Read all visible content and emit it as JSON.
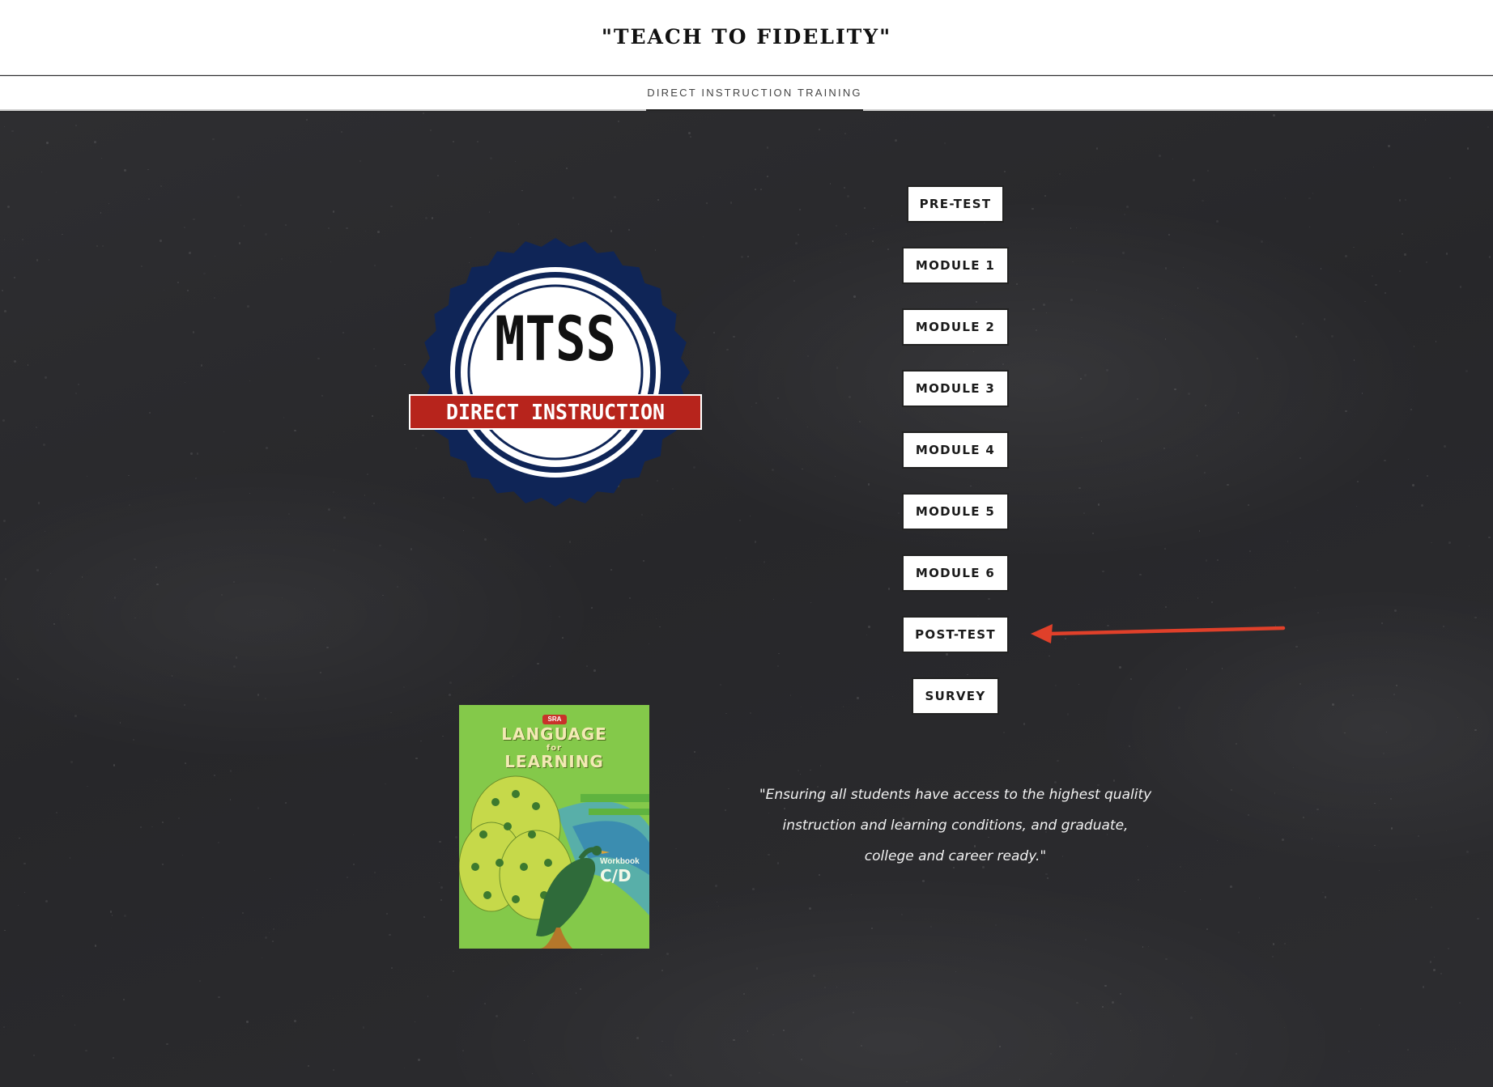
{
  "header": {
    "title": "\"TEACH TO FIDELITY\""
  },
  "nav": {
    "items": [
      {
        "label": "DIRECT INSTRUCTION TRAINING",
        "active": true
      }
    ]
  },
  "logo": {
    "name": "mtss-direct-instruction-badge",
    "line1": "MTSS",
    "banner": "DIRECT INSTRUCTION",
    "colors": {
      "ring": "#0f2557",
      "banner": "#b7241c"
    }
  },
  "buttons": [
    {
      "label": "PRE-TEST"
    },
    {
      "label": "MODULE 1"
    },
    {
      "label": "MODULE 2"
    },
    {
      "label": "MODULE 3"
    },
    {
      "label": "MODULE 4"
    },
    {
      "label": "MODULE 5"
    },
    {
      "label": "MODULE 6"
    },
    {
      "label": "POST-TEST"
    },
    {
      "label": "SURVEY"
    }
  ],
  "book": {
    "publisher": "SRA",
    "title_line1": "LANGUAGE",
    "title_line2": "for",
    "title_line3": "LEARNING",
    "subtitle": "Workbook",
    "level": "C/D"
  },
  "quote": "\"Ensuring all students have access to the highest quality instruction and learning conditions, and graduate, college and career ready.\"",
  "annotation": {
    "type": "arrow-icon",
    "color": "#e0402a",
    "points_to": "POST-TEST"
  }
}
